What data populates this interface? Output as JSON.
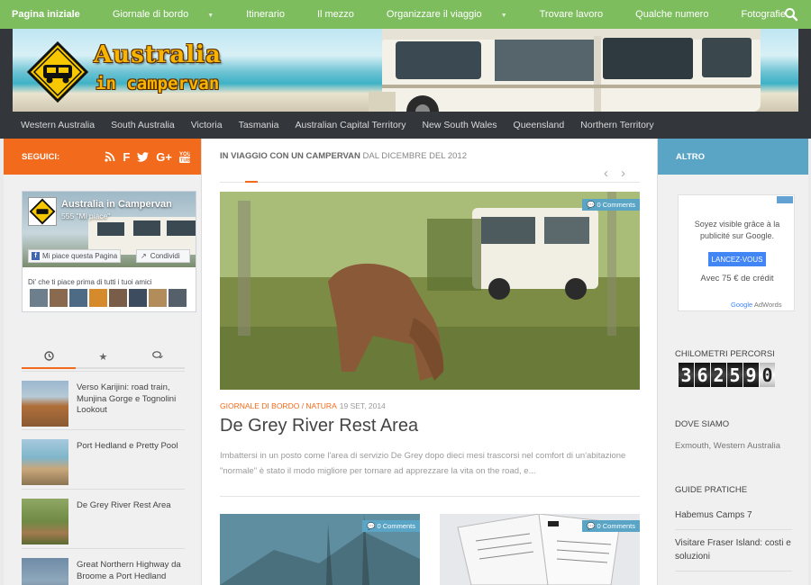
{
  "top_nav": {
    "items": [
      {
        "label": "Pagina iniziale",
        "active": true,
        "dropdown": false
      },
      {
        "label": "Giornale di bordo",
        "active": false,
        "dropdown": true
      },
      {
        "label": "Itinerario",
        "active": false,
        "dropdown": false
      },
      {
        "label": "Il mezzo",
        "active": false,
        "dropdown": false
      },
      {
        "label": "Organizzare il viaggio",
        "active": false,
        "dropdown": true
      },
      {
        "label": "Trovare lavoro",
        "active": false,
        "dropdown": false
      },
      {
        "label": "Qualche numero",
        "active": false,
        "dropdown": false
      },
      {
        "label": "Fotografie",
        "active": false,
        "dropdown": false
      }
    ],
    "search_icon": "search-icon",
    "bar_color": "#7dbd5e"
  },
  "header": {
    "logo_line1": "Australia",
    "logo_line2": "in campervan"
  },
  "region_nav": {
    "items": [
      "Western Australia",
      "South Australia",
      "Victoria",
      "Tasmania",
      "Australian Capital Territory",
      "New South Wales",
      "Queensland",
      "Northern Territory"
    ]
  },
  "left_sidebar": {
    "header_label": "SEGUICI:",
    "header_color": "#f26a1b",
    "follow_icons": [
      "rss-icon",
      "facebook-icon",
      "twitter-icon",
      "google-plus-icon",
      "youtube-icon"
    ],
    "facebook_box": {
      "page_name": "Australia in Campervan",
      "likes": "555 \"Mi piace\"",
      "like_button": "Mi piace questa Pagina",
      "share_button": "Condividi",
      "friends_text": "Di' che ti piace prima di tutti i tuoi amici"
    },
    "tabs": [
      {
        "icon": "clock-icon",
        "active": true
      },
      {
        "icon": "star-icon",
        "active": false
      },
      {
        "icon": "comments-icon",
        "active": false
      }
    ],
    "recent_posts": [
      {
        "title": "Verso Karijini: road train, Munjina Gorge e Tognolini Lookout"
      },
      {
        "title": "Port Hedland e Pretty Pool"
      },
      {
        "title": "De Grey River Rest Area"
      },
      {
        "title": "Great Northern Highway da Broome a Port Hedland"
      }
    ]
  },
  "main": {
    "heading": "IN VIAGGIO CON UN CAMPERVAN",
    "heading_since": "DAL DICEMBRE DEL 2012",
    "featured": {
      "comments": "0 Comments",
      "category1": "GIORNALE DI BORDO",
      "category2": "NATURA",
      "date": "19 SET, 2014",
      "title": "De Grey River Rest Area",
      "excerpt": "Imbattersi in un posto come l'area di servizio De Grey dopo dieci mesi trascorsi nel comfort di un'abitazione \"normale\" è stato il modo migliore per tornare ad apprezzare la vita on the road, e..."
    },
    "sub_posts": [
      {
        "comments": "0 Comments"
      },
      {
        "comments": "0 Comments"
      }
    ],
    "accent_color": "#f26a1b"
  },
  "right_sidebar": {
    "header_label": "ALTRO",
    "header_color": "#5aa5c6",
    "ad": {
      "text": "Soyez visible grâce à la publicité sur Google.",
      "button": "LANCEZ-VOUS",
      "price": "Avec 75 € de crédit",
      "footer_google": "Google",
      "footer_adwords": "AdWords"
    },
    "km_label": "CHILOMETRI PERCORSI",
    "odometer_digits": [
      "3",
      "6",
      "2",
      "5",
      "9",
      "0"
    ],
    "where_label": "DOVE SIAMO",
    "where_value": "Exmouth, Western Australia",
    "guides_label": "GUIDE PRATICHE",
    "guides": [
      "Habemus Camps 7",
      "Visitare Fraser Island: costi e soluzioni"
    ]
  }
}
